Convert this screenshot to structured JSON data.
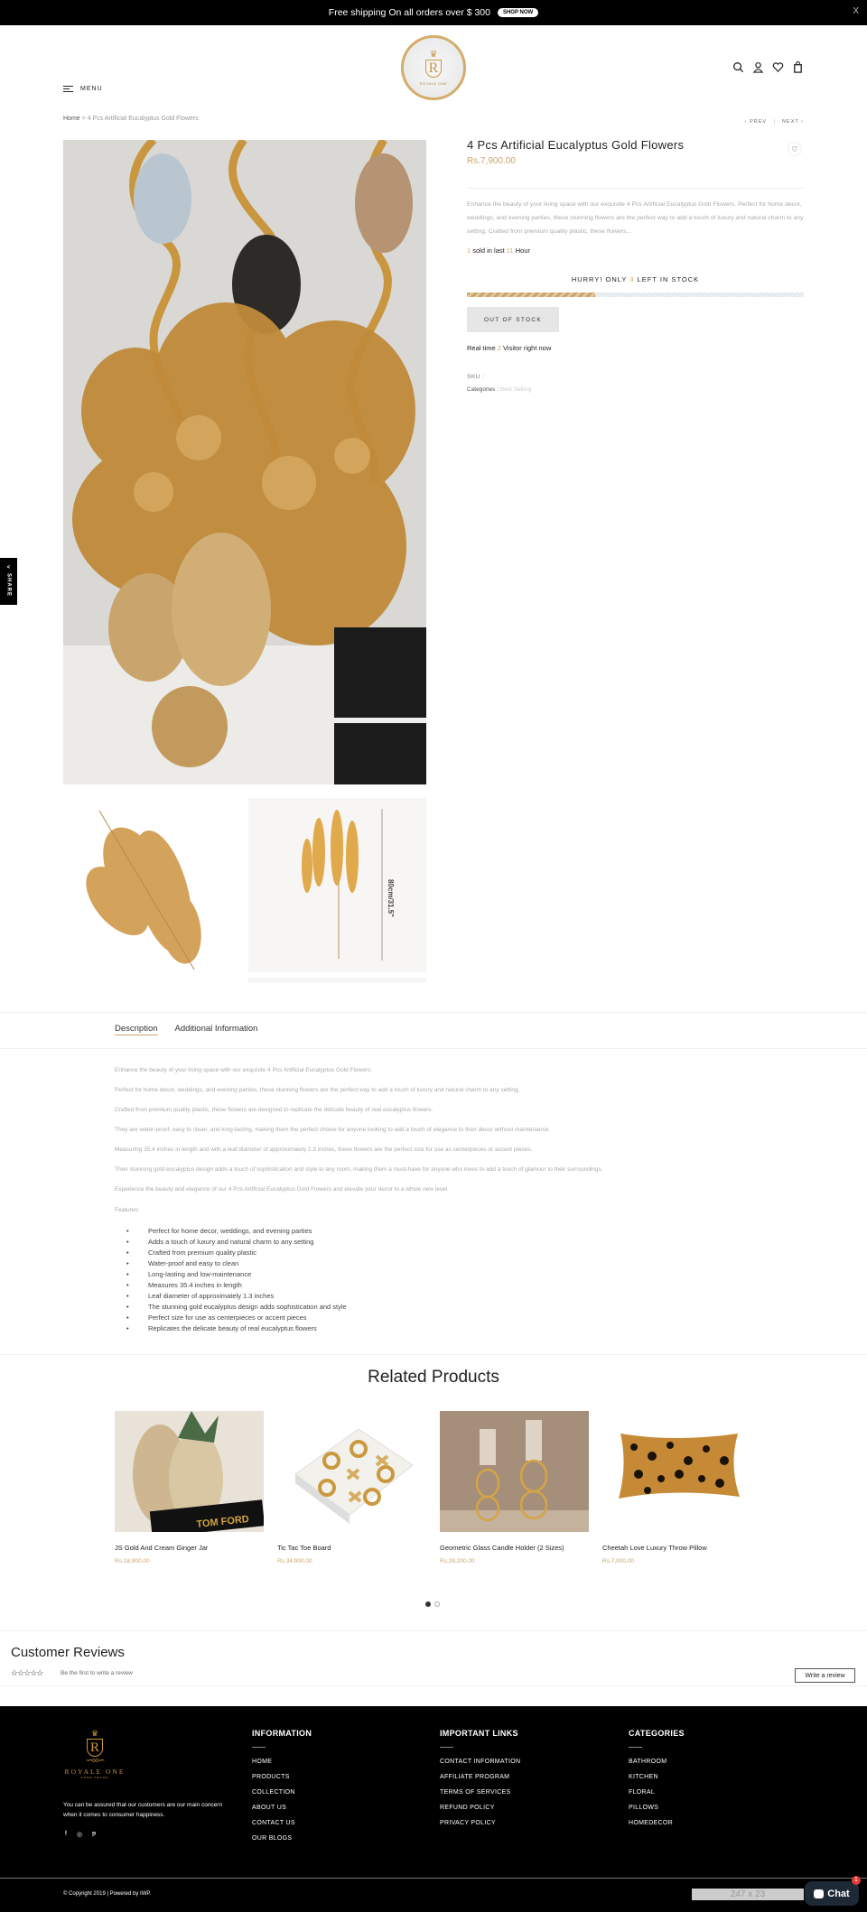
{
  "announcement": {
    "text": "Free shipping On all orders over $ 300",
    "cta": "SHOP NOW",
    "close": "X"
  },
  "header": {
    "menu_label": "MENU",
    "logo_line1": "ROYALE ONE",
    "logo_line2": "HOME DECOR",
    "icons": [
      "search-icon",
      "account-icon",
      "heart-icon",
      "cart-icon"
    ]
  },
  "breadcrumb": {
    "home": "Home",
    "separator": ">",
    "current": "4 Pcs Artificial Eucalyptus Gold Flowers"
  },
  "pager": {
    "prev": "‹ PREV",
    "next": "NEXT ›"
  },
  "product": {
    "title": "4 Pcs Artificial Eucalyptus Gold Flowers",
    "price": "Rs.7,900.00",
    "short_desc": "Enhance the beauty of your living space with our exquisite 4 Pcs Artificial Eucalyptus Gold Flowers. Perfect for home decor, weddings, and evening parties, these stunning flowers are the perfect way to add a touch of luxury and natural charm to any setting. Crafted from premium quality plastic, these flowers...",
    "sold_count": "1",
    "sold_mid": "sold in last",
    "sold_hours": "11",
    "sold_suffix": "Hour",
    "hurry_prefix": "HURRY! ONLY",
    "stock_left": "3",
    "hurry_suffix": "LEFT IN STOCK",
    "stock_progress_percent": 38,
    "button": "OUT OF STOCK",
    "visitor_prefix": "Real time",
    "visitors": "2",
    "visitor_suffix": "Visitor right now",
    "sku_label": "SKU :",
    "categories_label": "Categories :",
    "categories_value": "Best Selling",
    "thumb_dimension_label": "80cm/31.5\""
  },
  "share": {
    "label": "SHARE"
  },
  "tabs": [
    {
      "label": "Description",
      "active": true
    },
    {
      "label": "Additional Information",
      "active": false
    }
  ],
  "description": {
    "paragraphs": [
      "Enhance the beauty of your living space with our exquisite 4 Pcs Artificial Eucalyptus Gold Flowers.",
      "Perfect for home decor, weddings, and evening parties, these stunning flowers are the perfect way to add a touch of luxury and natural charm to any setting.",
      "Crafted from premium quality plastic, these flowers are designed to replicate the delicate beauty of real eucalyptus flowers.",
      "They are water-proof, easy to clean, and long-lasting, making them the perfect choice for anyone looking to add a touch of elegance to their decor without maintenance.",
      "Measuring 35.4 inches in length and with a leaf diameter of approximately 1.3 inches, these flowers are the perfect size for use as centerpieces or accent pieces.",
      "Their stunning gold eucalyptus design adds a touch of sophistication and style to any room, making them a must-have for anyone who loves to add a touch of glamour to their surroundings.",
      "Experience the beauty and elegance of our 4 Pcs Artificial Eucalyptus Gold Flowers and elevate your decor to a whole new level."
    ],
    "features_label": "Features:",
    "features": [
      "Perfect for home decor, weddings, and evening parties",
      "Adds a touch of luxury and natural charm to any setting",
      "Crafted from premium quality plastic",
      "Water-proof and easy to clean",
      "Long-lasting and low-maintenance",
      "Measures 35.4 inches in length",
      "Leaf diameter of approximately 1.3 inches",
      "The stunning gold eucalyptus design adds sophistication and style",
      "Perfect size for use as centerpieces or accent pieces",
      "Replicates the delicate beauty of real eucalyptus flowers"
    ]
  },
  "related": {
    "title": "Related Products",
    "items": [
      {
        "name": "JS Gold And Cream Ginger Jar",
        "price": "Rs.18,900.00",
        "img_label": "TOM FORD"
      },
      {
        "name": "Tic Tac Toe Board",
        "price": "Rs.34,900.00"
      },
      {
        "name": "Geometric Glass Candle Holder (2 Sizes)",
        "price": "Rs.28,200.00"
      },
      {
        "name": "Cheetah Love Luxury Throw Pillow",
        "price": "Rs.7,900.00"
      }
    ],
    "pages": 2,
    "current_page": 1
  },
  "reviews": {
    "title": "Customer Reviews",
    "stars": "☆☆☆☆☆",
    "empty": "Be the first to write a review",
    "write": "Write a review"
  },
  "footer": {
    "logo_line1": "ROYALE ONE",
    "logo_line2": "HOME DECOR",
    "about": "You can be assured that our customers are our main concern when it comes to consumer happiness.",
    "social": [
      "facebook-icon",
      "instagram-icon",
      "pinterest-icon"
    ],
    "columns": [
      {
        "title": "INFORMATION",
        "links": [
          "HOME",
          "PRODUCTS",
          "COLLECTION",
          "ABOUT US",
          "CONTACT US",
          "OUR BLOGS"
        ]
      },
      {
        "title": "IMPORTANT LINKS",
        "links": [
          "CONTACT INFORMATION",
          "AFFILIATE PROGRAM",
          "TERMS OF SERVICES",
          "REFUND POLICY",
          "PRIVACY POLICY"
        ]
      },
      {
        "title": "CATEGORIES",
        "links": [
          "BATHROOM",
          "KITCHEN",
          "FLORAL",
          "PILLOWS",
          "HOMEDECOR"
        ]
      }
    ],
    "copyright": "© Copyright 2019 | Powered by IWP.",
    "placeholder": "247 x 23"
  },
  "chat": {
    "label": "Chat",
    "badge": "1"
  },
  "colors": {
    "accent": "#c9a56e",
    "footer_bg": "#000000",
    "chat_bg": "#1d2a36"
  }
}
